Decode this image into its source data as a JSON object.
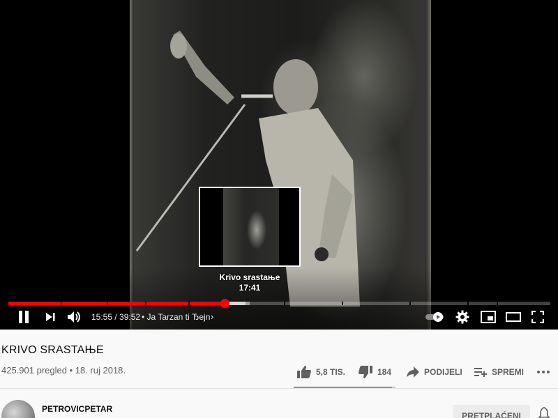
{
  "player": {
    "current_time": "15:55",
    "duration": "39:52",
    "time_display": "15:55 / 39:52",
    "chapter_title": "• Ja Tarzan ti Ђejn",
    "progress_played_fraction": 0.399,
    "progress_loaded_fraction": 0.445,
    "hover_time_fraction": 0.437,
    "preview": {
      "title": "Krivo srastaњe",
      "time": "17:41"
    },
    "controls": {
      "pause_icon": "pause-icon",
      "next_icon": "skip-next-icon",
      "volume_icon": "volume-high-icon",
      "autoplay_icon": "autoplay-toggle-icon",
      "settings_icon": "gear-icon",
      "miniplayer_icon": "miniplayer-icon",
      "theater_icon": "theater-mode-icon",
      "fullscreen_icon": "fullscreen-icon"
    },
    "colors": {
      "progress_played": "#ff0000",
      "background": "#000000"
    }
  },
  "video": {
    "title": "KRIVO SRASTAЊЕ",
    "meta": "425.901 pregled • 18. ruj 2018."
  },
  "actions": {
    "like_count": "5,8 TIS.",
    "dislike_count": "184",
    "share_label": "PODIJELI",
    "save_label": "SPREMI",
    "like_fraction": 0.969
  },
  "channel": {
    "name": "PETROVICPETAR",
    "subscribe_label": "PRETPLAĆENI"
  }
}
